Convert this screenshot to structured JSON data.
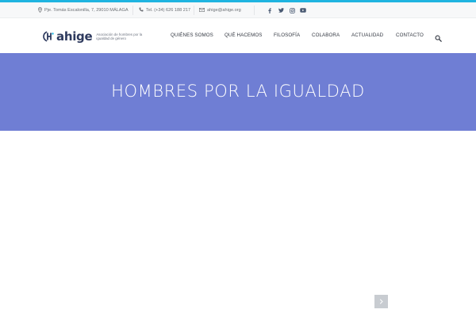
{
  "topbar": {
    "address": "Pje. Tomás Escalonilla, 7, 29010 MÁLAGA",
    "phone": "Tel. (+34) 626 188 217",
    "email": "ahige@ahige.org",
    "social": [
      "facebook-icon",
      "twitter-icon",
      "instagram-icon",
      "youtube-icon"
    ],
    "accent_color": "#1fb4e0"
  },
  "header": {
    "logo_text": "ahige",
    "logo_tagline": "Asociación de hombres por la igualdad de género",
    "nav": [
      "QUIÉNES SOMOS",
      "QUÉ HACEMOS",
      "FILOSOFÍA",
      "COLABORA",
      "ACTUALIDAD",
      "CONTACTO"
    ],
    "search_icon": "search-icon"
  },
  "hero": {
    "title": "HOMBRES POR LA IGUALDAD",
    "background_color": "#6f7ed4"
  },
  "slider": {
    "next_icon": "chevron-right-icon"
  }
}
